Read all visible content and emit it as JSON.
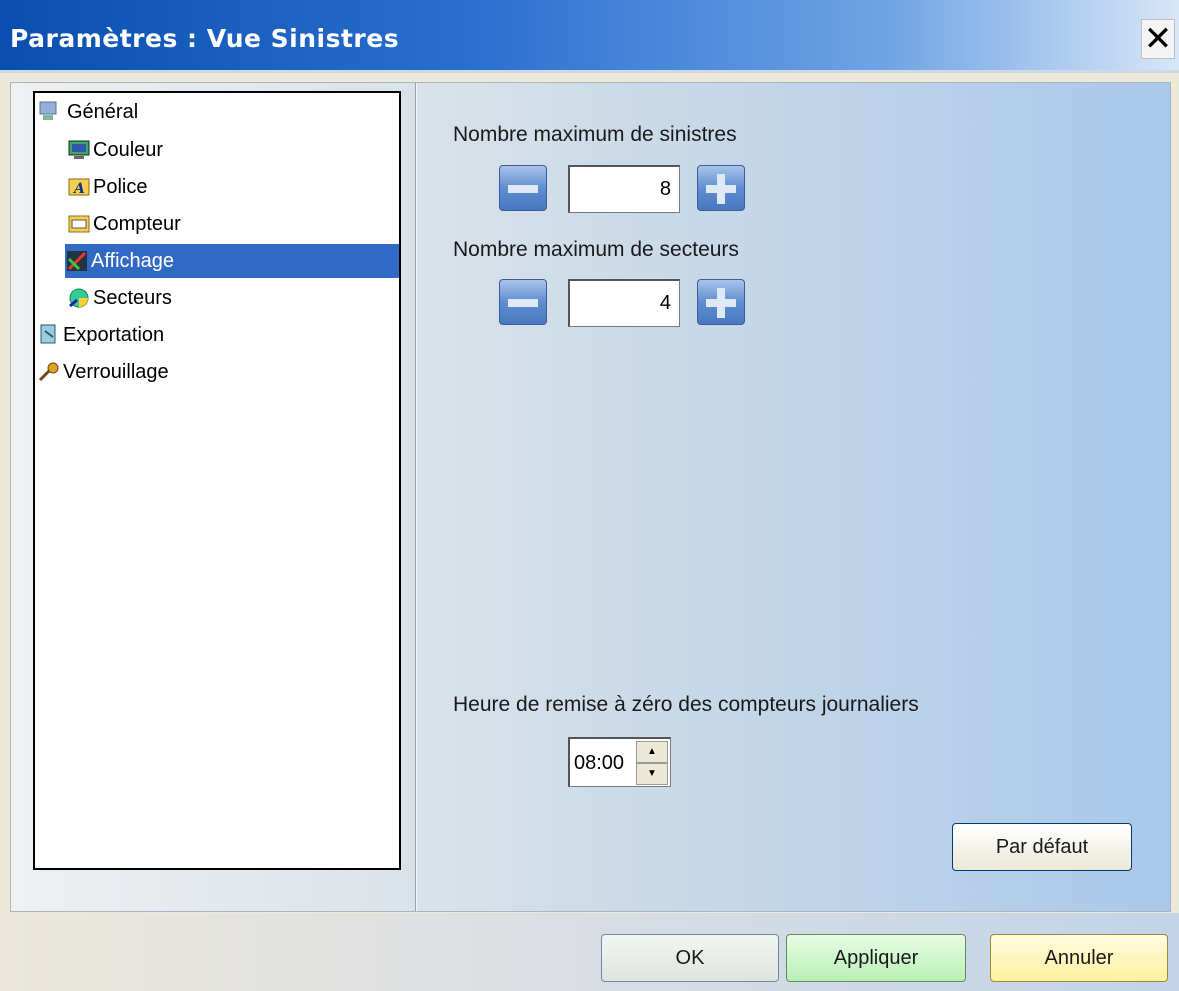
{
  "window": {
    "title": "Paramètres : Vue Sinistres",
    "close_glyph": "✕"
  },
  "tree": {
    "items": [
      {
        "label": "Général",
        "icon": "settings-icon",
        "level": 0
      },
      {
        "label": "Couleur",
        "icon": "monitor-icon",
        "level": 1
      },
      {
        "label": "Police",
        "icon": "font-icon",
        "level": 1
      },
      {
        "label": "Compteur",
        "icon": "counter-icon",
        "level": 1
      },
      {
        "label": "Affichage",
        "icon": "display-icon",
        "level": 1,
        "selected": true
      },
      {
        "label": "Secteurs",
        "icon": "sectors-icon",
        "level": 1
      },
      {
        "label": "Exportation",
        "icon": "export-icon",
        "level": 0
      },
      {
        "label": "Verrouillage",
        "icon": "key-icon",
        "level": 0
      }
    ]
  },
  "settings": {
    "max_sinistres_label": "Nombre maximum de sinistres",
    "max_sinistres_value": "8",
    "max_secteurs_label": "Nombre maximum de secteurs",
    "max_secteurs_value": "4",
    "reset_time_label": "Heure de remise à zéro des compteurs journaliers",
    "reset_time_value": "08:00",
    "default_button": "Par défaut"
  },
  "footer": {
    "ok": "OK",
    "apply": "Appliquer",
    "cancel": "Annuler"
  },
  "colors": {
    "title_bar": "#0a4fb0",
    "selection": "#316ac5"
  }
}
